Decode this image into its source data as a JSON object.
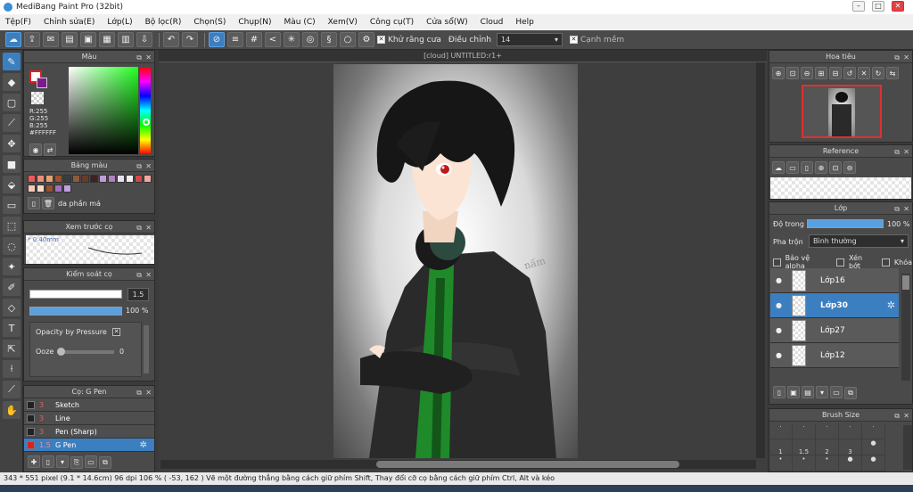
{
  "app": {
    "title": "MediBang Paint Pro (32bit)"
  },
  "window_controls": {
    "minimize": "–",
    "maximize": "□",
    "close": "✕"
  },
  "menu": [
    "Tệp(F)",
    "Chỉnh sửa(E)",
    "Lớp(L)",
    "Bộ lọc(R)",
    "Chọn(S)",
    "Chụp(N)",
    "Màu (C)",
    "Xem(V)",
    "Công cụ(T)",
    "Cửa sổ(W)",
    "Cloud",
    "Help"
  ],
  "toolbar": {
    "antialias_label": "Khử răng cưa",
    "correction_label": "Điều chỉnh",
    "correction_value": "14",
    "sharp_edges_label": "Cạnh mềm"
  },
  "panels": {
    "color": {
      "title": "Màu",
      "r": "R:255",
      "g": "G:255",
      "b": "B:255",
      "hex": "#FFFFFF",
      "accent": "#e02020"
    },
    "palette": {
      "title": "Bảng màu",
      "name": "da phần má",
      "swatches": [
        "#e85a5a",
        "#f08a7a",
        "#e8a070",
        "#a05030",
        "#3c3c3c",
        "#8c5a3c",
        "#6a3a2a",
        "#402020",
        "#c09cd8",
        "#b080c0",
        "#e8e0f0",
        "#f0f0f0",
        "#d04848",
        "#f0a8a0",
        "#f8c8b8",
        "#ffd8c8",
        "#9c5030",
        "#a070c0",
        "#c0a0e0"
      ]
    },
    "brush_preview": {
      "title": "Xem trước cọ",
      "size": "* 0.40mm"
    },
    "brush_control": {
      "title": "Kiểm soát cọ",
      "size_value": "1.5",
      "opacity_value": "100 %",
      "opacity_pressure_label": "Opacity by Pressure",
      "ooze_label": "Ooze",
      "ooze_value": "0"
    },
    "brush_list": {
      "title": "Cọ: G Pen",
      "items": [
        {
          "size": "3",
          "name": "Sketch"
        },
        {
          "size": "3",
          "name": "Line"
        },
        {
          "size": "3",
          "name": "Pen (Sharp)"
        },
        {
          "size": "1.5",
          "name": "G Pen"
        }
      ]
    },
    "navigator": {
      "title": "Hoa tiêu"
    },
    "reference": {
      "title": "Reference"
    },
    "layers": {
      "title": "Lớp",
      "opacity_label": "Độ trong",
      "opacity_value": "100 %",
      "blend_label": "Pha trộn",
      "blend_value": "Bình thường",
      "protect_alpha": "Bảo vệ alpha",
      "clipping": "Xén bớt",
      "lock": "Khóa",
      "items": [
        {
          "name": "Lớp16"
        },
        {
          "name": "Lớp30"
        },
        {
          "name": "Lớp27"
        },
        {
          "name": "Lớp12"
        }
      ]
    },
    "brush_size": {
      "title": "Brush Size",
      "labels": [
        "1",
        "1.5",
        "2",
        "3"
      ]
    }
  },
  "document": {
    "tab": "[cloud] UNTITLED:r1+"
  },
  "status": {
    "text": "343 * 551 pixel  (9.1 * 14.6cm)  96 dpi  106 %  ( -53, 162 )  Vẽ một đường thẳng bằng cách giữ phím Shift, Thay đổi cỡ cọ bằng cách giữ phím Ctrl, Alt và kéo"
  },
  "icons": [
    "brush-icon",
    "eraser-icon",
    "select-rect-icon",
    "move-icon",
    "fill-icon",
    "text-icon",
    "eyedropper-icon",
    "hand-icon",
    "cloud-icon",
    "undo-icon",
    "redo-icon",
    "zoom-in-icon",
    "zoom-out-icon",
    "gear-icon"
  ]
}
